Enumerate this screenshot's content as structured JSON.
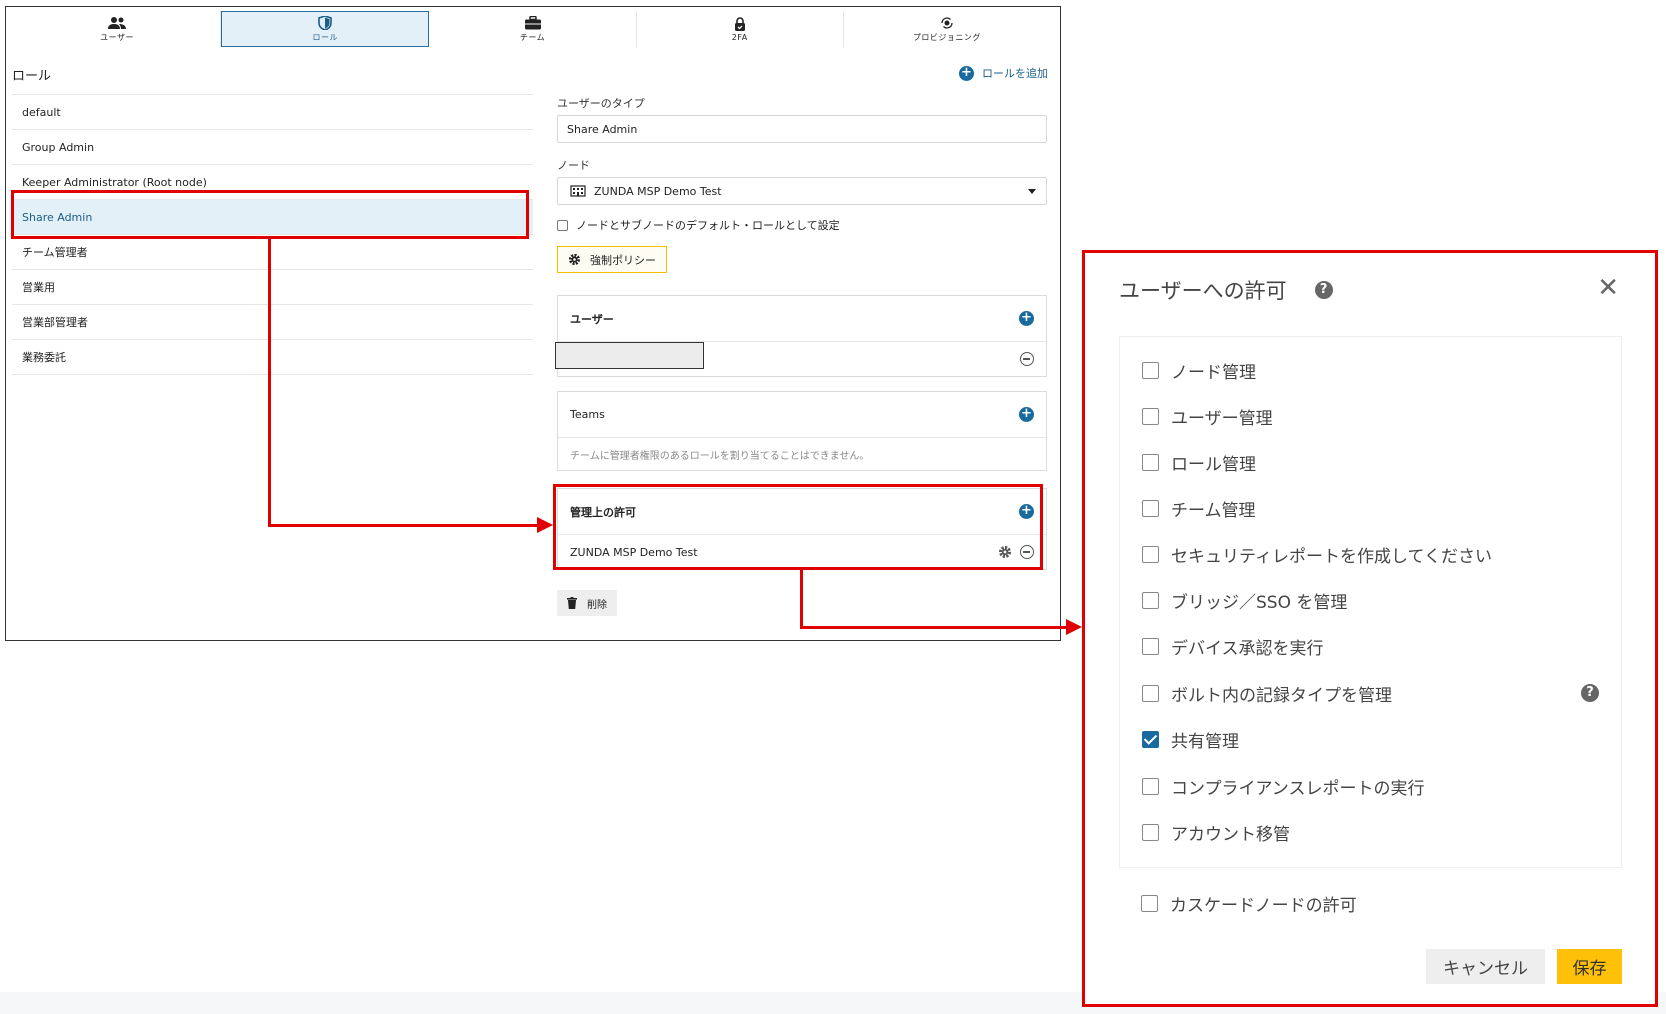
{
  "tabs": [
    {
      "label": "ユーザー",
      "icon": "users-icon"
    },
    {
      "label": "ロール",
      "icon": "shield-icon",
      "active": true
    },
    {
      "label": "チーム",
      "icon": "briefcase-icon"
    },
    {
      "label": "2FA",
      "icon": "lock-icon"
    },
    {
      "label": "プロビジョニング",
      "icon": "provisioning-icon"
    }
  ],
  "roles_section": {
    "title": "ロール",
    "add_label": "ロールを追加",
    "items": [
      "default",
      "Group Admin",
      "Keeper Administrator (Root node)",
      "Share Admin",
      "チーム管理者",
      "営業用",
      "営業部管理者",
      "業務委託"
    ],
    "selected": "Share Admin"
  },
  "role_detail": {
    "user_type_label": "ユーザーのタイプ",
    "user_type_value": "Share Admin",
    "node_label": "ノード",
    "node_value": "ZUNDA MSP Demo Test",
    "default_role_checkbox": "ノードとサブノードのデフォルト・ロールとして設定",
    "policy_button": "強制ポリシー",
    "users_card_title": "ユーザー",
    "teams_card_title": "Teams",
    "teams_note": "チームに管理者権限のあるロールを割り当てることはできません。",
    "admin_perm_title": "管理上の許可",
    "admin_perm_node": "ZUNDA MSP Demo Test",
    "delete_button": "削除"
  },
  "dialog": {
    "title": "ユーザーへの許可",
    "permissions": [
      {
        "label": "ノード管理",
        "checked": false
      },
      {
        "label": "ユーザー管理",
        "checked": false
      },
      {
        "label": "ロール管理",
        "checked": false
      },
      {
        "label": "チーム管理",
        "checked": false
      },
      {
        "label": "セキュリティレポートを作成してください",
        "checked": false
      },
      {
        "label": "ブリッジ／SSO を管理",
        "checked": false
      },
      {
        "label": "デバイス承認を実行",
        "checked": false
      },
      {
        "label": "ボルト内の記録タイプを管理",
        "checked": false
      },
      {
        "label": "共有管理",
        "checked": true
      },
      {
        "label": "コンプライアンスレポートの実行",
        "checked": false
      },
      {
        "label": "アカウント移管",
        "checked": false
      }
    ],
    "cascade_label": "カスケードノードの許可",
    "cancel_label": "キャンセル",
    "save_label": "保存"
  },
  "colors": {
    "accent": "#1a6aa0",
    "annotation": "#e00000",
    "save_button": "#ffc107"
  }
}
